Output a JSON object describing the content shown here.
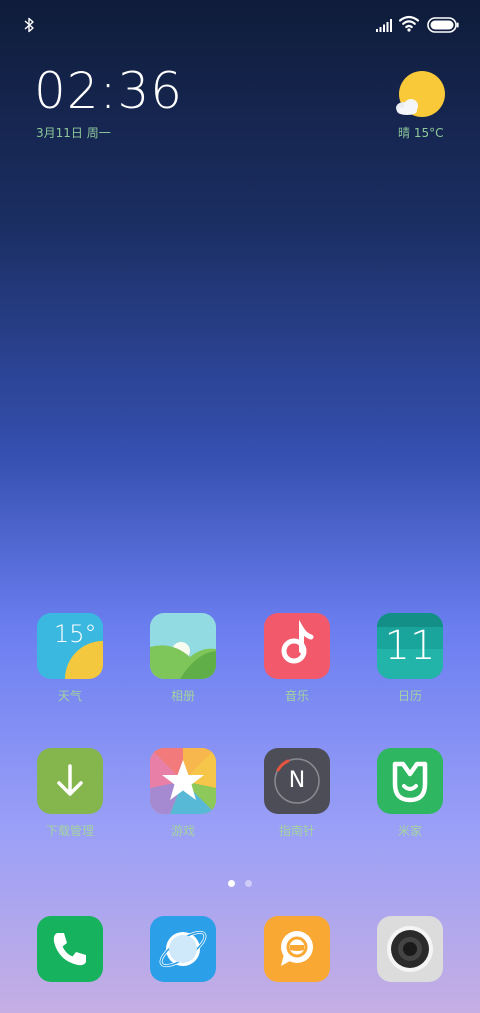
{
  "status_bar": {
    "left_icons": [
      "bluetooth-icon"
    ],
    "right_icons": [
      "cellular-signal-icon",
      "wifi-icon",
      "battery-icon"
    ]
  },
  "clock_widget": {
    "time": "02:36",
    "date": "3月11日 周一"
  },
  "weather_widget": {
    "icon": "partly-sunny-icon",
    "condition": "晴",
    "temperature": "15°C"
  },
  "home_apps": [
    {
      "label": "天气",
      "icon": "weather-app-icon",
      "tile_text": "15°"
    },
    {
      "label": "相册",
      "icon": "gallery-icon"
    },
    {
      "label": "音乐",
      "icon": "music-icon"
    },
    {
      "label": "日历",
      "icon": "calendar-icon",
      "tile_text": "11"
    },
    {
      "label": "下载管理",
      "icon": "download-icon"
    },
    {
      "label": "游戏",
      "icon": "game-star-icon"
    },
    {
      "label": "指南针",
      "icon": "compass-icon",
      "tile_text": "N"
    },
    {
      "label": "米家",
      "icon": "mijia-icon"
    }
  ],
  "page_indicator": {
    "current": 1,
    "total": 2
  },
  "dock": [
    {
      "icon": "phone-icon"
    },
    {
      "icon": "browser-icon"
    },
    {
      "icon": "messaging-icon"
    },
    {
      "icon": "camera-icon"
    }
  ],
  "colors": {
    "weather_tile": "#3bb8e0",
    "gallery_tile": "#8fd7df",
    "music_tile": "#f2596b",
    "calendar_tile": "#1aa59c",
    "download_tile": "#85b64d",
    "compass_tile": "#4d4d57",
    "mijia_tile": "#2fb661",
    "phone_tile": "#17b25d",
    "browser_tile": "#2b9fe8",
    "messaging_tile": "#f8a833",
    "camera_tile": "#d9d9d9",
    "date_text": "#8ec79a"
  }
}
